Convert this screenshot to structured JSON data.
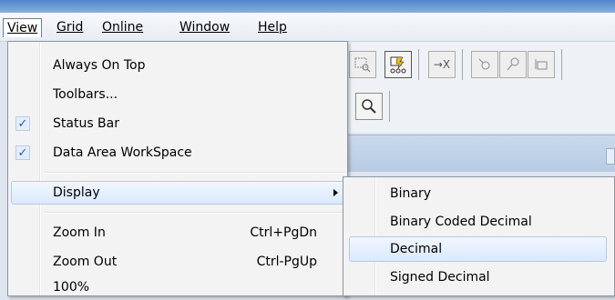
{
  "menubar": {
    "items": [
      "View",
      "Grid",
      "Online",
      "Window",
      "Help"
    ]
  },
  "toolbar": {
    "icons": [
      "zoom-region-icon",
      "online-monitor-icon",
      "force-x-icon",
      "probe-icon",
      "probe-add-icon",
      "probe-grid-icon",
      "magnifier-icon"
    ],
    "force_label": "→X"
  },
  "view_menu": {
    "items": [
      {
        "label": "Always On Top",
        "checked": false
      },
      {
        "label": "Toolbars...",
        "checked": false
      },
      {
        "label": "Status Bar",
        "checked": true
      },
      {
        "label": "Data Area WorkSpace",
        "checked": true
      },
      {
        "label": "Display",
        "submenu": true
      },
      {
        "label": "Zoom In",
        "shortcut": "Ctrl+PgDn"
      },
      {
        "label": "Zoom Out",
        "shortcut": "Ctrl-PgUp"
      },
      {
        "label": "100%"
      }
    ],
    "check_glyph": "✓"
  },
  "display_submenu": {
    "items": [
      "Binary",
      "Binary Coded Decimal",
      "Decimal",
      "Signed Decimal"
    ],
    "highlighted": "Decimal"
  }
}
